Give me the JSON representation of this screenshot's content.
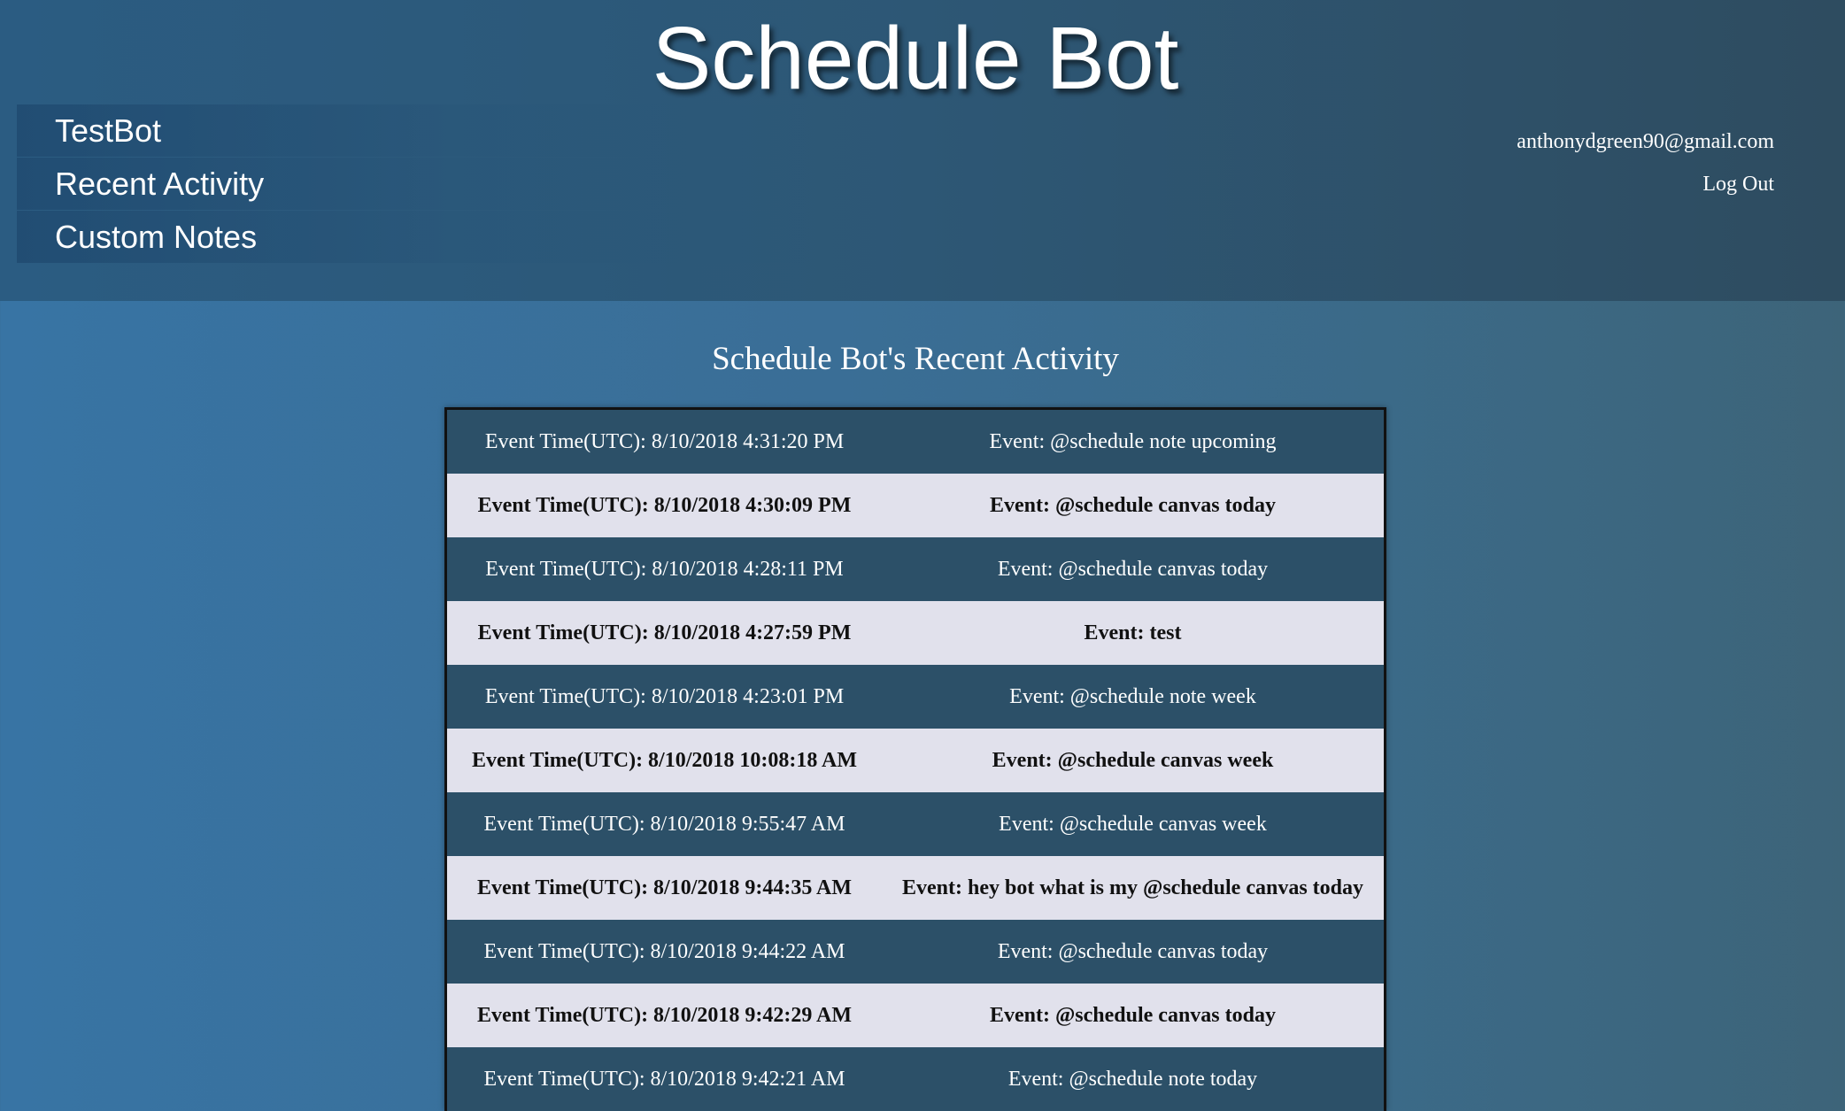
{
  "header": {
    "title": "Schedule Bot"
  },
  "nav": {
    "items": [
      {
        "label": "TestBot"
      },
      {
        "label": "Recent Activity"
      },
      {
        "label": "Custom Notes"
      }
    ]
  },
  "account": {
    "email": "anthonydgreen90@gmail.com",
    "logout_label": "Log Out"
  },
  "main": {
    "heading": "Schedule Bot's Recent Activity",
    "rows": [
      {
        "time": "Event Time(UTC): 8/10/2018 4:31:20 PM",
        "event": "Event: @schedule note upcoming"
      },
      {
        "time": "Event Time(UTC): 8/10/2018 4:30:09 PM",
        "event": "Event: @schedule canvas today"
      },
      {
        "time": "Event Time(UTC): 8/10/2018 4:28:11 PM",
        "event": "Event: @schedule canvas today"
      },
      {
        "time": "Event Time(UTC): 8/10/2018 4:27:59 PM",
        "event": "Event: test"
      },
      {
        "time": "Event Time(UTC): 8/10/2018 4:23:01 PM",
        "event": "Event: @schedule note week"
      },
      {
        "time": "Event Time(UTC): 8/10/2018 10:08:18 AM",
        "event": "Event: @schedule canvas week"
      },
      {
        "time": "Event Time(UTC): 8/10/2018 9:55:47 AM",
        "event": "Event: @schedule canvas week"
      },
      {
        "time": "Event Time(UTC): 8/10/2018 9:44:35 AM",
        "event": "Event: hey bot what is my @schedule canvas today"
      },
      {
        "time": "Event Time(UTC): 8/10/2018 9:44:22 AM",
        "event": "Event: @schedule canvas today"
      },
      {
        "time": "Event Time(UTC): 8/10/2018 9:42:29 AM",
        "event": "Event: @schedule canvas today"
      },
      {
        "time": "Event Time(UTC): 8/10/2018 9:42:21 AM",
        "event": "Event: @schedule note today"
      }
    ]
  },
  "colors": {
    "header_bg": "#2d5775",
    "page_bg": "#3874a4",
    "row_dark": "#2c5068",
    "row_light": "#e1e1ec"
  }
}
